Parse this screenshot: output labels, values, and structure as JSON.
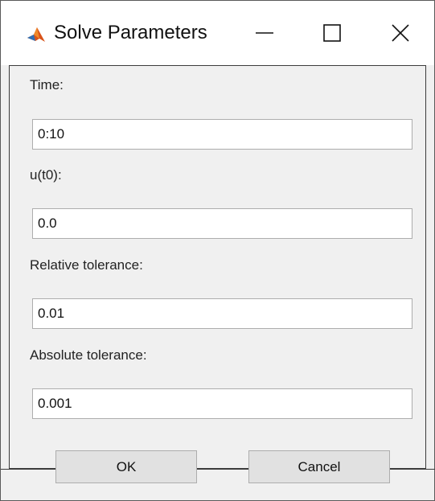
{
  "window": {
    "title": "Solve Parameters",
    "app_icon": "matlab-icon",
    "controls": {
      "minimize_icon": "minimize-icon",
      "maximize_icon": "maximize-icon",
      "close_icon": "close-icon"
    }
  },
  "form": {
    "time": {
      "label": "Time:",
      "value": "0:10"
    },
    "u0": {
      "label": "u(t0):",
      "value": "0.0"
    },
    "reltol": {
      "label": "Relative tolerance:",
      "value": "0.01"
    },
    "abstol": {
      "label": "Absolute tolerance:",
      "value": "0.001"
    }
  },
  "buttons": {
    "ok": "OK",
    "cancel": "Cancel"
  },
  "colors": {
    "background": "#f0f0f0",
    "border": "#3c3c3c",
    "field_border": "#adadad",
    "button_bg": "#e1e1e1",
    "icon_accent": "#d95319"
  }
}
